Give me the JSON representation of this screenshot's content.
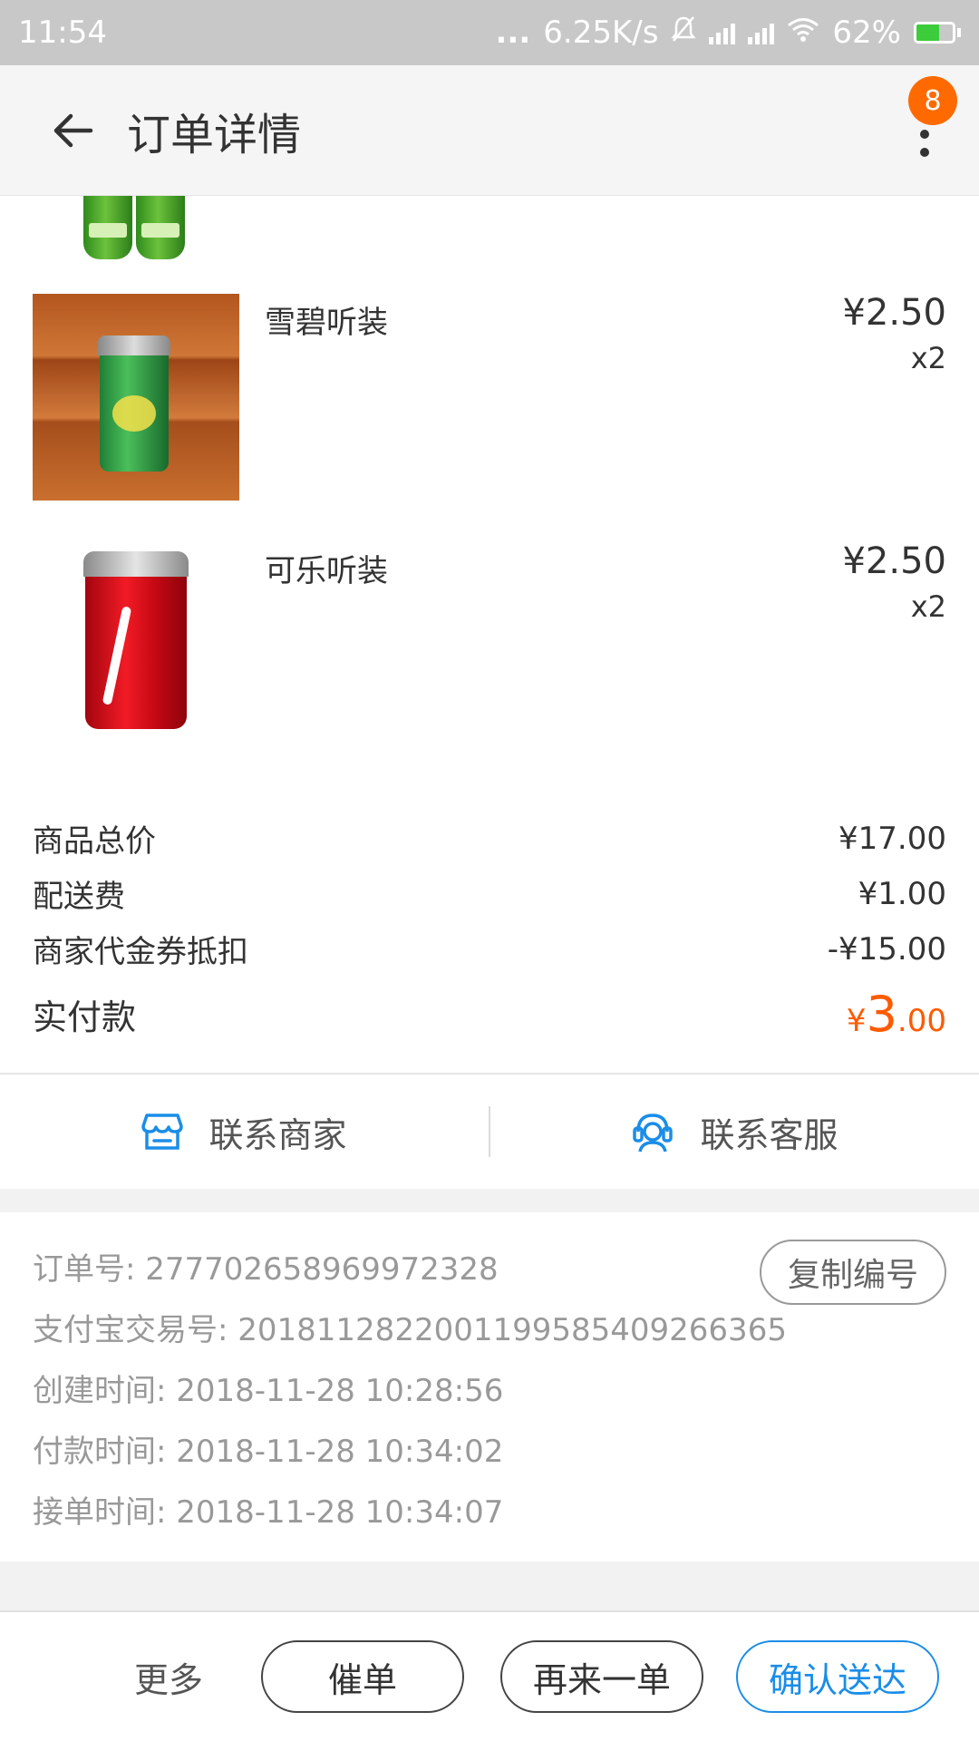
{
  "status_bar": {
    "time": "11:54",
    "dots": "...",
    "speed": "6.25K/s",
    "battery": "62%",
    "battery_level": 0.62
  },
  "app_bar": {
    "title": "订单详情",
    "badge": "8"
  },
  "products": [
    {
      "name": "雪碧听装",
      "price": "¥2.50",
      "qty": "x2"
    },
    {
      "name": "可乐听装",
      "price": "¥2.50",
      "qty": "x2"
    }
  ],
  "summary": {
    "goods_label": "商品总价",
    "goods_value": "¥17.00",
    "delivery_label": "配送费",
    "delivery_value": "¥1.00",
    "coupon_label": "商家代金券抵扣",
    "coupon_value": "-¥15.00",
    "paid_label": "实付款",
    "paid_currency": "¥",
    "paid_integer": "3",
    "paid_decimal": ".00"
  },
  "contact": {
    "merchant": "联系商家",
    "service": "联系客服"
  },
  "order_info": {
    "order_no": "订单号: 277702658969972328",
    "copy_label": "复制编号",
    "alipay_no": "支付宝交易号: 2018112822001199585409266365",
    "created": "创建时间: 2018-11-28 10:28:56",
    "paid": "付款时间: 2018-11-28 10:34:02",
    "accepted": "接单时间: 2018-11-28 10:34:07"
  },
  "bottom_bar": {
    "more": "更多",
    "urge": "催单",
    "reorder": "再来一单",
    "confirm": "确认送达"
  },
  "colors": {
    "accent_orange": "#ff5a00",
    "accent_blue": "#1a8de8",
    "badge": "#ff6a00"
  }
}
